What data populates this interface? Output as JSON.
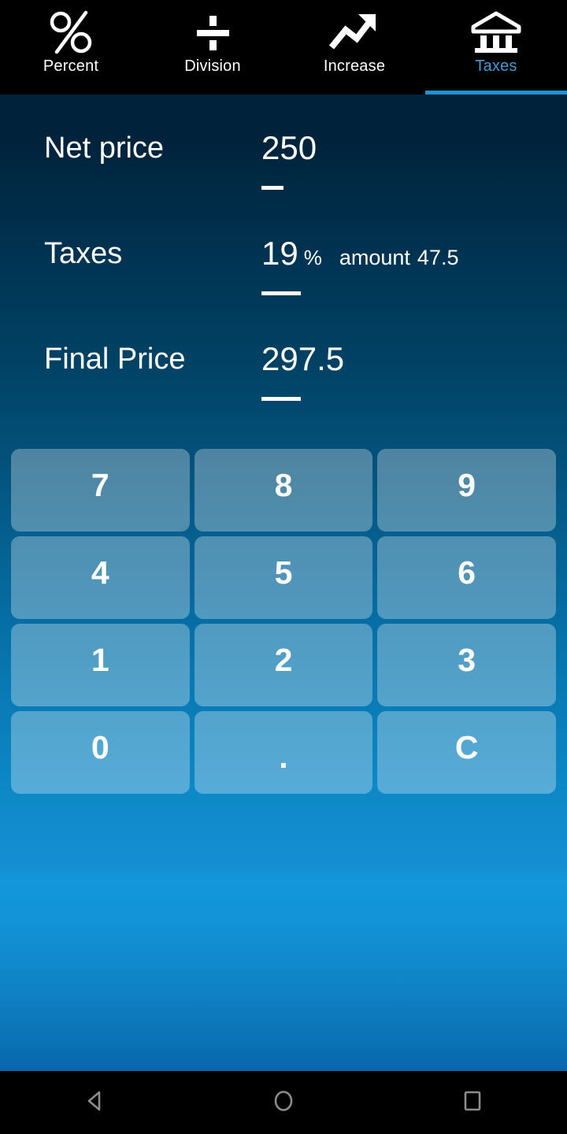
{
  "tabs": [
    {
      "label": "Percent",
      "icon": "percent-icon",
      "active": false
    },
    {
      "label": "Division",
      "icon": "division-icon",
      "active": false
    },
    {
      "label": "Increase",
      "icon": "trending-up-icon",
      "active": false
    },
    {
      "label": "Taxes",
      "icon": "bank-icon",
      "active": true
    }
  ],
  "fields": {
    "net_price": {
      "label": "Net price",
      "value": "250"
    },
    "taxes": {
      "label": "Taxes",
      "value": "19",
      "unit": "%",
      "amount_label": "amount",
      "amount_value": "47.5"
    },
    "final_price": {
      "label": "Final Price",
      "value": "297.5"
    }
  },
  "keypad": [
    [
      "7",
      "8",
      "9"
    ],
    [
      "4",
      "5",
      "6"
    ],
    [
      "1",
      "2",
      "3"
    ],
    [
      "0",
      ".",
      "C"
    ]
  ],
  "navbar": [
    {
      "name": "back-icon"
    },
    {
      "name": "home-icon"
    },
    {
      "name": "recents-icon"
    }
  ],
  "colors": {
    "accent": "#1e93cd",
    "active_tab_text": "#3f9dd6",
    "tabbar_bg": "#000000",
    "gradient_top": "#00223a",
    "gradient_bottom": "#0865ab",
    "key_text": "#ffffff"
  }
}
